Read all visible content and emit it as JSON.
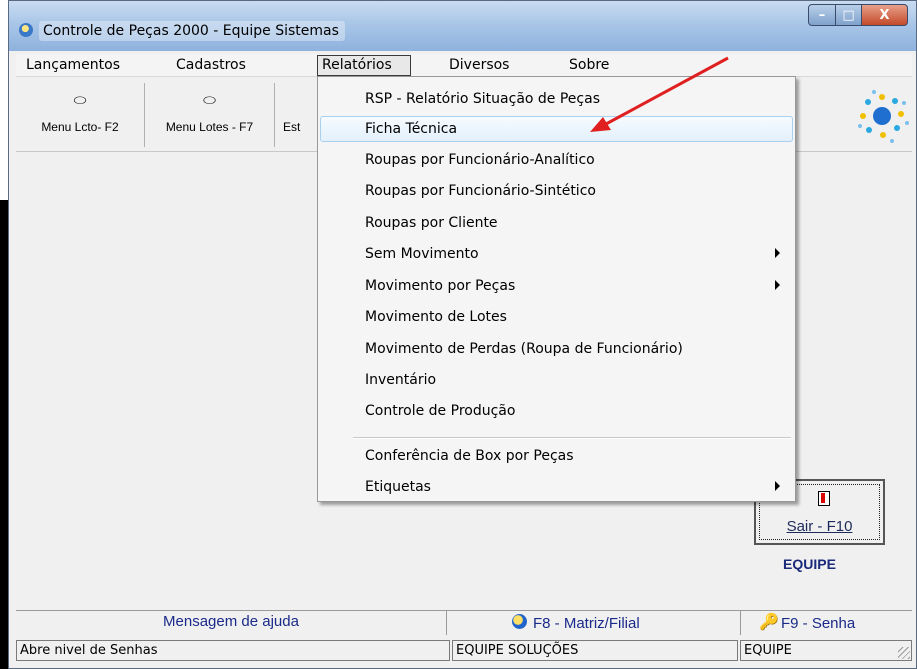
{
  "window": {
    "title": "Controle de Peças 2000 - Equipe Sistemas",
    "caption_buttons": {
      "minimize": "–",
      "maximize": "□",
      "close": "X"
    }
  },
  "menubar": {
    "items": [
      "Lançamentos",
      "Cadastros",
      "Relatórios",
      "Diversos",
      "Sobre"
    ],
    "active": "Relatórios"
  },
  "toolbar": {
    "buttons": [
      {
        "label": "Menu Lcto- F2",
        "icon": "book-icon"
      },
      {
        "label": "Menu Lotes - F7",
        "icon": "book-icon"
      },
      {
        "label": "Est",
        "icon": ""
      }
    ],
    "logo": "equipe-dots-logo"
  },
  "dropdown": {
    "items": [
      {
        "label": "RSP - Relatório Situação de Peças",
        "submenu": false
      },
      {
        "label": "Ficha Técnica",
        "submenu": false,
        "highlighted": true
      },
      {
        "label": "Roupas por Funcionário-Analítico",
        "submenu": false
      },
      {
        "label": "Roupas por Funcionário-Sintético",
        "submenu": false
      },
      {
        "label": "Roupas por Cliente",
        "submenu": false
      },
      {
        "label": "Sem Movimento",
        "submenu": true
      },
      {
        "label": "Movimento por Peças",
        "submenu": true
      },
      {
        "label": "Movimento de Lotes",
        "submenu": false
      },
      {
        "label": "Movimento de Perdas (Roupa de Funcionário)",
        "submenu": false
      },
      {
        "label": "Inventário",
        "submenu": false
      },
      {
        "label": "Controle de Produção",
        "submenu": false
      },
      {
        "label": "Conferência de Box por Peças",
        "submenu": false
      },
      {
        "label": "Etiquetas",
        "submenu": true
      }
    ]
  },
  "exit_button": {
    "label": "Sair - F10",
    "icon": "door-icon"
  },
  "brand": "EQUIPE",
  "helpbar": {
    "message": "Mensagem de ajuda",
    "f8_label": "F8 - Matriz/Filial",
    "f9_label": "F9 - Senha"
  },
  "statusbar": {
    "left": "Abre nivel de Senhas",
    "middle": "EQUIPE SOLUÇÕES",
    "right": "EQUIPE"
  },
  "colors": {
    "annotation_arrow": "#e02020",
    "menu_highlight": "#e3f0fb",
    "brand_text": "#1a2a7a"
  }
}
